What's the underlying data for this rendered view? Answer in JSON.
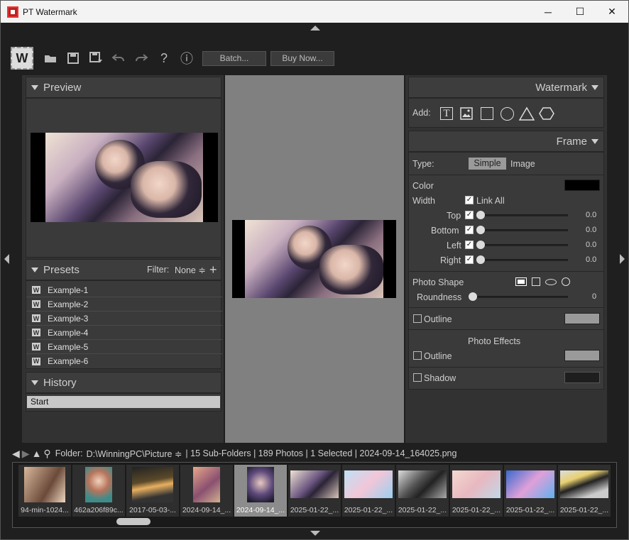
{
  "window": {
    "title": "PT Watermark",
    "minimize": "─",
    "maximize": "☐",
    "close": "✕"
  },
  "toolbar": {
    "logo": "W",
    "batch_label": "Batch...",
    "buy_label": "Buy Now...",
    "help": "?",
    "info": "ⓘ"
  },
  "preview": {
    "title": "Preview"
  },
  "presets": {
    "title": "Presets",
    "filter_label": "Filter:",
    "filter_value": "None ≑",
    "add": "+",
    "items": [
      "Example-1",
      "Example-2",
      "Example-3",
      "Example-4",
      "Example-5",
      "Example-6"
    ]
  },
  "history": {
    "title": "History",
    "items": [
      "Start"
    ]
  },
  "watermark": {
    "title": "Watermark",
    "add_label": "Add:",
    "text_icon": "T"
  },
  "frame": {
    "title": "Frame",
    "type_label": "Type:",
    "type_simple": "Simple",
    "type_image": "Image",
    "color_label": "Color",
    "color_value": "#000000",
    "width_label": "Width",
    "link_all": "Link All",
    "sides": [
      {
        "label": "Top",
        "value": "0.0"
      },
      {
        "label": "Bottom",
        "value": "0.0"
      },
      {
        "label": "Left",
        "value": "0.0"
      },
      {
        "label": "Right",
        "value": "0.0"
      }
    ],
    "photo_shape_label": "Photo Shape",
    "roundness_label": "Roundness",
    "roundness_value": "0",
    "outline_label": "Outline",
    "outline_color": "#9a9a9a",
    "photo_effects_label": "Photo Effects",
    "effects_outline_label": "Outline",
    "effects_outline_color": "#9a9a9a",
    "shadow_label": "Shadow",
    "shadow_color": "#1e1e1e"
  },
  "status": {
    "folder_label": "Folder:",
    "folder_path": "D:\\WinningPC\\Picture ≑",
    "summary": "| 15 Sub-Folders | 189 Photos | 1 Selected | 2024-09-14_164025.png"
  },
  "thumbnails": [
    {
      "caption": "94-min-1024...",
      "selected": false
    },
    {
      "caption": "462a206f89c...",
      "selected": false
    },
    {
      "caption": "2017-05-03-...",
      "selected": false
    },
    {
      "caption": "2024-09-14_...",
      "selected": false
    },
    {
      "caption": "2024-09-14_...",
      "selected": true
    },
    {
      "caption": "2025-01-22_...",
      "selected": false
    },
    {
      "caption": "2025-01-22_...",
      "selected": false
    },
    {
      "caption": "2025-01-22_...",
      "selected": false
    },
    {
      "caption": "2025-01-22_...",
      "selected": false
    },
    {
      "caption": "2025-01-22_...",
      "selected": false
    },
    {
      "caption": "2025-01-22_...",
      "selected": false
    }
  ]
}
